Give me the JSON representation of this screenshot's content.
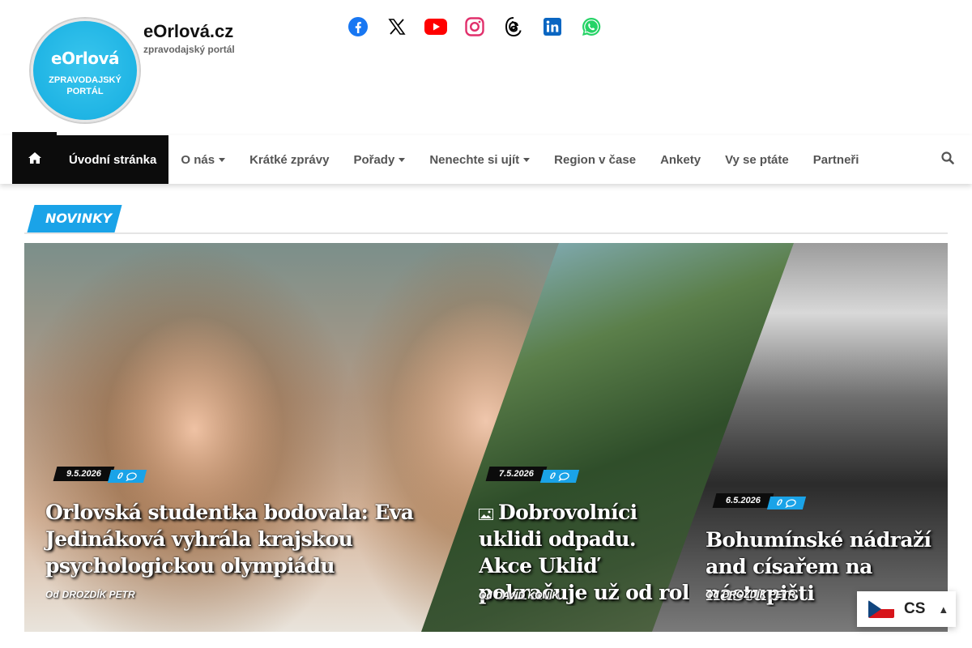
{
  "site": {
    "logo_brand": "eOrlová",
    "logo_sub_line1": "ZPRAVODAJSKÝ",
    "logo_sub_line2": "PORTÁL",
    "title": "eOrlová.cz",
    "description": "zpravodajský portál"
  },
  "social": [
    {
      "icon": "facebook-icon",
      "color": "#1877f2"
    },
    {
      "icon": "x-icon",
      "color": "#000000"
    },
    {
      "icon": "youtube-icon",
      "color": "#ff0000"
    },
    {
      "icon": "instagram-icon",
      "color": "#e1306c"
    },
    {
      "icon": "threads-icon",
      "color": "#000000"
    },
    {
      "icon": "linkedin-icon",
      "color": "#0a66c2"
    },
    {
      "icon": "whatsapp-icon",
      "color": "#25d366"
    }
  ],
  "nav": {
    "items": [
      {
        "label": "Úvodní stránka",
        "active": true,
        "dropdown": false
      },
      {
        "label": "O nás",
        "active": false,
        "dropdown": true
      },
      {
        "label": "Krátké zprávy",
        "active": false,
        "dropdown": false
      },
      {
        "label": "Pořady",
        "active": false,
        "dropdown": true
      },
      {
        "label": "Nenechte si ujít",
        "active": false,
        "dropdown": true
      },
      {
        "label": "Region v čase",
        "active": false,
        "dropdown": false
      },
      {
        "label": "Ankety",
        "active": false,
        "dropdown": false
      },
      {
        "label": "Vy se ptáte",
        "active": false,
        "dropdown": false
      },
      {
        "label": "Partneři",
        "active": false,
        "dropdown": false
      }
    ]
  },
  "section": {
    "heading": "NOVINKY"
  },
  "slides": [
    {
      "date": "9.5.2026",
      "comments": "0",
      "title": "Orlovská studentka bodovala: Eva Jedináková vyhrála krajskou psychologickou olympiádu",
      "author_prefix": "Od",
      "author": "DROZDÍK PETR"
    },
    {
      "date": "7.5.2026",
      "comments": "0",
      "title": "Dobrovolníci uklidi odpadu. Akce Ukliď pokračuje už od rol",
      "author_prefix": "Od",
      "author": "DAVID KONÍK"
    },
    {
      "date": "6.5.2026",
      "comments": "0",
      "title": "Bohumínské nádraží and císařem na nástupišti",
      "author_prefix": "Od",
      "author": "DROZDÍK PETR"
    }
  ],
  "language": {
    "code": "CS"
  },
  "colors": {
    "accent": "#1aa3e8",
    "dark": "#0c0c0c"
  }
}
